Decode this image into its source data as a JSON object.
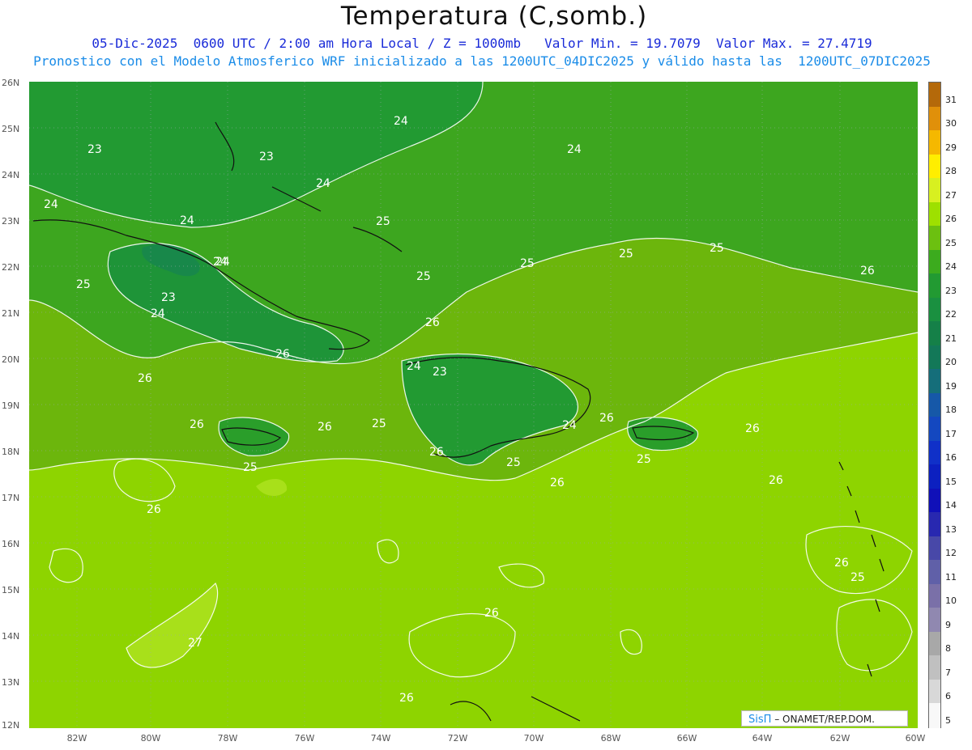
{
  "header": {
    "title": "Temperatura (C,somb.)",
    "line1": "05-Dic-2025  0600 UTC / 2:00 am Hora Local / Z = 1000mb   Valor Min. = 19.7079  Valor Max. = 27.4719",
    "line2": "Pronostico con el Modelo Atmosferico WRF inicializado a las 1200UTC_04DIC2025 y válido hasta las  1200UTC_07DIC2025"
  },
  "lat_labels": [
    "26N",
    "25N",
    "24N",
    "23N",
    "22N",
    "21N",
    "20N",
    "19N",
    "18N",
    "17N",
    "16N",
    "15N",
    "14N",
    "13N",
    "12N"
  ],
  "lon_labels": [
    "82W",
    "80W",
    "78W",
    "76W",
    "74W",
    "72W",
    "70W",
    "68W",
    "66W",
    "64W",
    "62W",
    "60W"
  ],
  "colorbar": {
    "labels": [
      "31",
      "30",
      "29",
      "28",
      "27",
      "26",
      "25",
      "24",
      "23",
      "22",
      "21",
      "20",
      "19",
      "18",
      "17",
      "16",
      "15",
      "14",
      "13",
      "12",
      "11",
      "10",
      "9",
      "8",
      "7",
      "6",
      "5"
    ],
    "colors": [
      "#b4690a",
      "#e0900a",
      "#f5b800",
      "#ffee00",
      "#d8f020",
      "#9ee000",
      "#6cc010",
      "#3cab1e",
      "#229a32",
      "#1a9040",
      "#158048",
      "#137858",
      "#156e7a",
      "#1658a8",
      "#1448c0",
      "#1030c8",
      "#0c20c0",
      "#1010b8",
      "#2828b0",
      "#4848a8",
      "#6060a8",
      "#7a70a8",
      "#9088b0",
      "#a8a8a8",
      "#c0c0c0",
      "#d8d8d8",
      "#f8f8f8"
    ]
  },
  "contour_labels": [
    "24",
    "23",
    "23",
    "24",
    "24",
    "24",
    "24",
    "25",
    "23",
    "24",
    "24",
    "25",
    "26",
    "26",
    "25",
    "25",
    "25",
    "24",
    "23",
    "26",
    "26",
    "25",
    "24",
    "26",
    "26",
    "25",
    "26",
    "26",
    "26",
    "26",
    "26",
    "27",
    "26",
    "24",
    "25",
    "25",
    "26",
    "25",
    "26",
    "26",
    "25"
  ],
  "brand": {
    "logo": "SisΠ",
    "text": " – ONAMET/REP.DOM."
  },
  "colors": {
    "sea_warm": "#8ed400",
    "mid": "#6cb60c",
    "cool": "#3da61f",
    "cold": "#229a32",
    "coldest": "#18884a",
    "warm_patch": "#a8e01a"
  }
}
